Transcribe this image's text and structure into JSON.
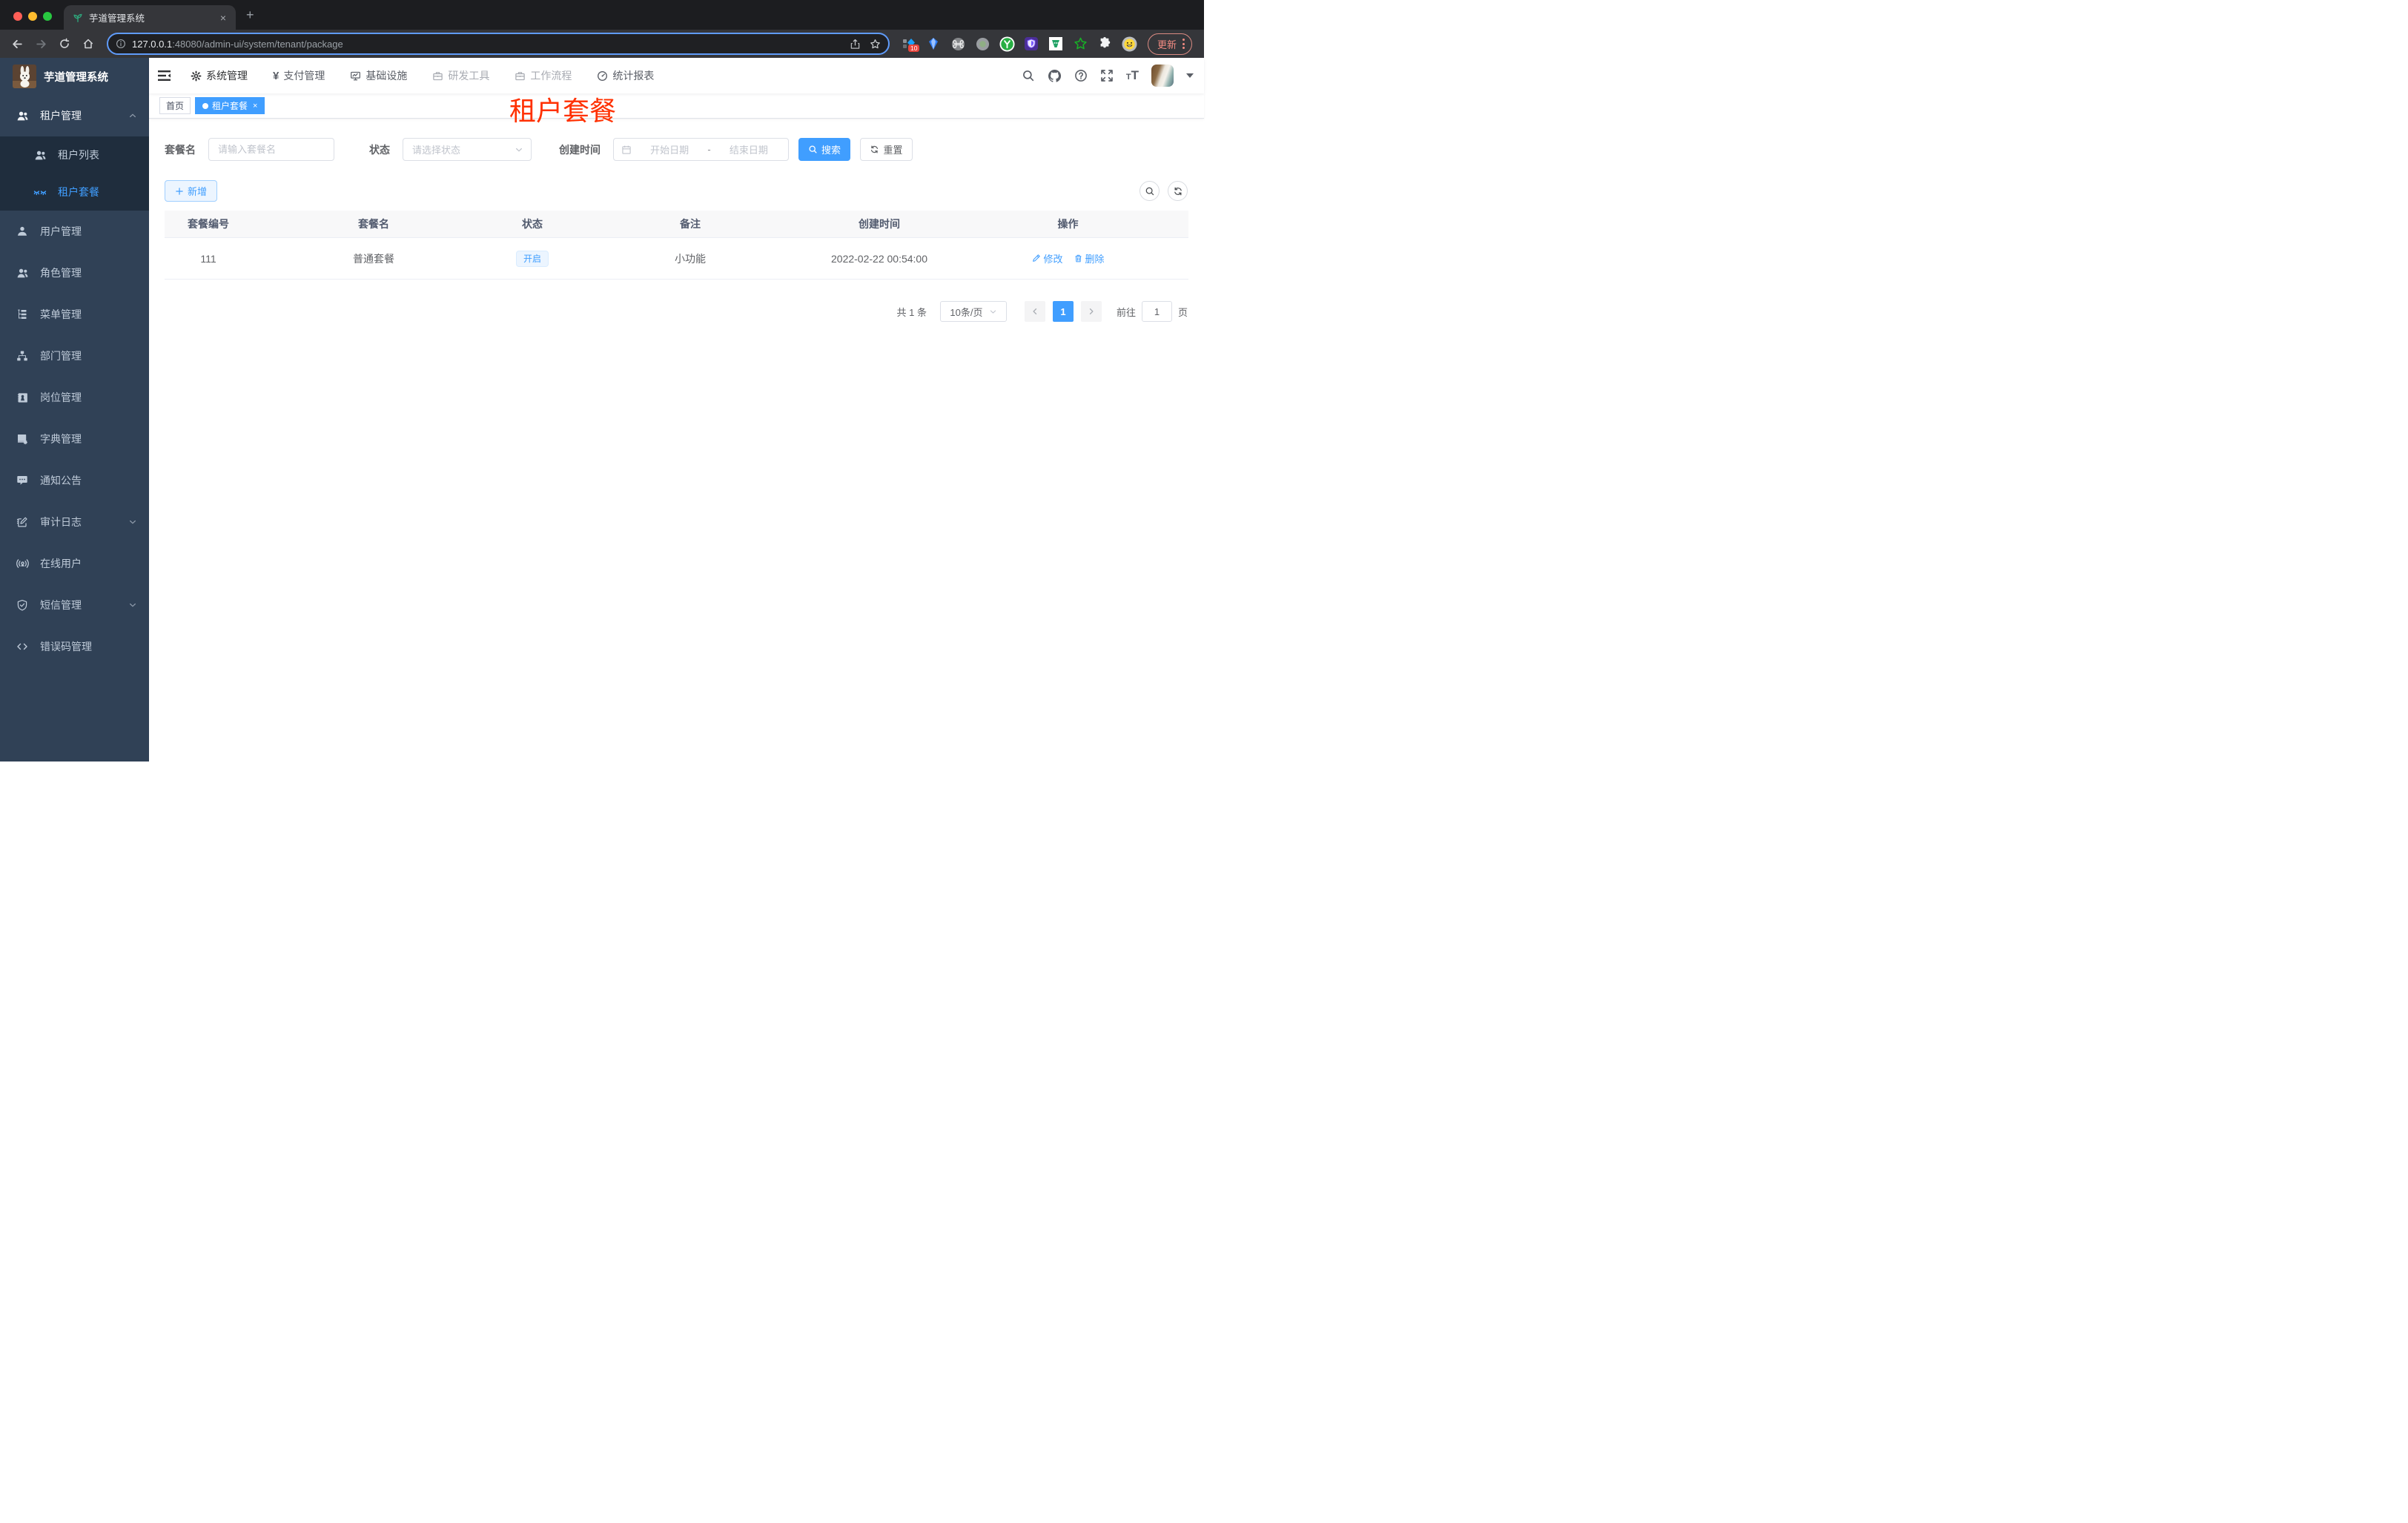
{
  "browser": {
    "tab_title": "芋道管理系统",
    "url_host": "127.0.0.1",
    "url_rest": ":48080/admin-ui/system/tenant/package",
    "extension_badge": "10",
    "update_label": "更新"
  },
  "sidebar": {
    "title": "芋道管理系统",
    "group_tenant": "租户管理",
    "sub_tenant_list": "租户列表",
    "sub_tenant_package": "租户套餐",
    "items": [
      "用户管理",
      "角色管理",
      "菜单管理",
      "部门管理",
      "岗位管理",
      "字典管理",
      "通知公告",
      "审计日志",
      "在线用户",
      "短信管理",
      "错误码管理"
    ]
  },
  "topnav": {
    "items": [
      "系统管理",
      "支付管理",
      "基础设施",
      "研发工具",
      "工作流程",
      "统计报表"
    ]
  },
  "tags": {
    "home": "首页",
    "active": "租户套餐"
  },
  "overlay": {
    "title": "租户套餐"
  },
  "filters": {
    "name_label": "套餐名",
    "name_placeholder": "请输入套餐名",
    "status_label": "状态",
    "status_placeholder": "请选择状态",
    "date_label": "创建时间",
    "date_start": "开始日期",
    "date_separator": "-",
    "date_end": "结束日期",
    "search": "搜索",
    "reset": "重置",
    "add": "新增"
  },
  "table": {
    "headers": [
      "套餐编号",
      "套餐名",
      "状态",
      "备注",
      "创建时间",
      "操作"
    ],
    "row": {
      "id": "111",
      "name": "普通套餐",
      "status": "开启",
      "remark": "小功能",
      "created_at": "2022-02-22 00:54:00",
      "edit": "修改",
      "delete": "删除"
    }
  },
  "pagination": {
    "total": "共 1 条",
    "page_size": "10条/页",
    "page": "1",
    "goto_label": "前往",
    "goto_value": "1",
    "unit": "页"
  },
  "colors": {
    "accent": "#409eff",
    "sidebar_bg": "#304156",
    "submenu_bg": "#1f2d3d",
    "overlay_red": "#ff3000"
  }
}
